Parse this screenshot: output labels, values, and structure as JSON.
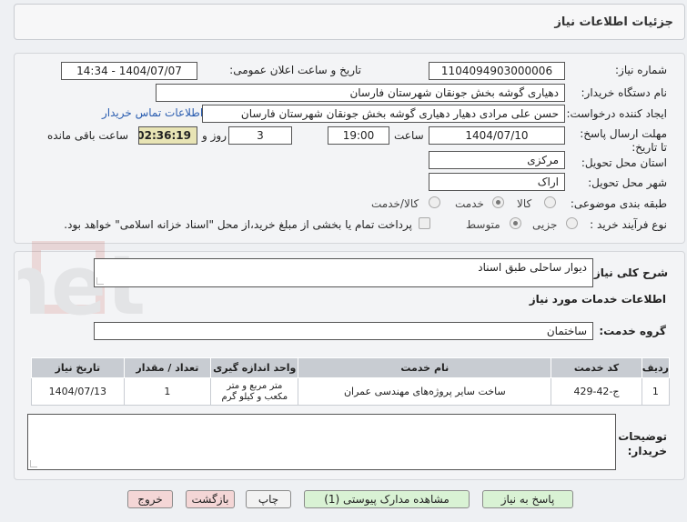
{
  "header": {
    "title": "جزئیات اطلاعات نیاز"
  },
  "form": {
    "need_number_label": "شماره نیاز:",
    "need_number": "1104094903000006",
    "announce_label": "تاریخ و ساعت اعلان عمومی:",
    "announce_value": "1404/07/07 - 14:34",
    "buyer_org_label": "نام دستگاه خریدار:",
    "buyer_org": "دهیاری گوشه بخش جونقان شهرستان فارسان",
    "creator_label": "ایجاد کننده درخواست:",
    "creator": "حسن علی مرادی دهیار دهیاری گوشه بخش جونقان شهرستان فارسان",
    "contact_link": "اطلاعات تماس خریدار",
    "deadline_label": "مهلت ارسال پاسخ: تا تاریخ:",
    "deadline_date": "1404/07/10",
    "time_label": "ساعت",
    "deadline_time": "19:00",
    "days_value": "3",
    "days_label": "روز و",
    "remaining_time": "02:36:19",
    "remaining_label": "ساعت باقی مانده",
    "province_label": "استان محل تحویل:",
    "province": "مرکزی",
    "city_label": "شهر محل تحویل:",
    "city": "اراک",
    "category_label": "طبقه بندی موضوعی:",
    "category_options": [
      "کالا",
      "خدمت",
      "کالا/خدمت"
    ],
    "category_selected": "خدمت",
    "process_label": "نوع فرآیند خرید :",
    "process_options": [
      "جزیی",
      "متوسط"
    ],
    "process_selected": "متوسط",
    "payment_note": "پرداخت تمام یا بخشی از مبلغ خرید،از محل \"اسناد خزانه اسلامی\" خواهد بود."
  },
  "description": {
    "label": "شرح کلی نیاز:",
    "value": "دیوار ساحلی طبق اسناد"
  },
  "services": {
    "section_title": "اطلاعات خدمات مورد نیاز",
    "group_label": "گروه خدمت:",
    "group_value": "ساختمان",
    "columns": [
      "ردیف",
      "کد خدمت",
      "نام خدمت",
      "واحد اندازه گیری",
      "تعداد / مقدار",
      "تاریخ نیاز"
    ],
    "rows": [
      {
        "row": "1",
        "code": "ج-42-429",
        "name": "ساخت سایر پروژه‌های مهندسی عمران",
        "unit": "متر مربع و متر مکعب و کیلو گرم",
        "qty": "1",
        "date": "1404/07/13"
      }
    ]
  },
  "notes": {
    "label": "توضیحات خریدار:",
    "value": ""
  },
  "buttons": {
    "reply": "پاسخ به نیاز",
    "attachments": "مشاهده مدارک پیوستی (1)",
    "print": "چاپ",
    "back": "بازگشت",
    "exit": "خروج"
  },
  "colors": {
    "timer_bg": "#e8e4b5",
    "header_table": "#c8ccd2",
    "link": "#2a5db0"
  }
}
